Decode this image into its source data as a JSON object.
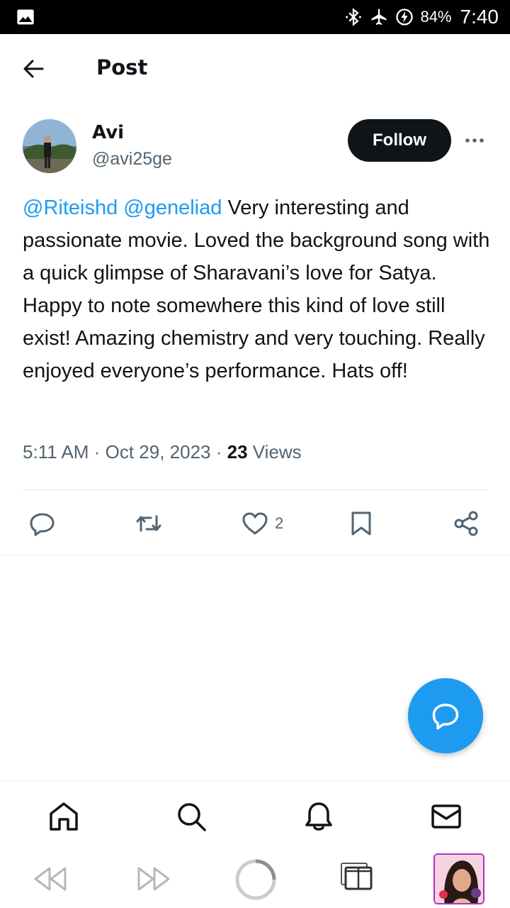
{
  "status_bar": {
    "battery": "84%",
    "time": "7:40",
    "icons": [
      "image-icon",
      "bluetooth-icon",
      "airplane-icon",
      "battery-saver-icon"
    ]
  },
  "header": {
    "title": "Post",
    "back_icon": "arrow-left-icon"
  },
  "author": {
    "name": "Avi",
    "handle": "@avi25ge",
    "follow_label": "Follow",
    "more_icon": "more-horizontal-icon"
  },
  "tweet": {
    "mention_1": "@Riteishd",
    "mention_2": "@geneliad",
    "text": "Very interesting and passionate movie. Loved the background song with a quick glimpse of Sharavani’s love for Satya. Happy to note somewhere this kind of love still exist! Amazing chemistry and very touching. Really enjoyed everyone’s performance. Hats off!",
    "time": "5:11 AM",
    "separator": "·",
    "date": "Oct 29, 2023",
    "views_count": "23",
    "views_label": "Views"
  },
  "actions": {
    "reply_icon": "reply-icon",
    "retweet_icon": "retweet-icon",
    "like_icon": "heart-icon",
    "like_count": "2",
    "bookmark_icon": "bookmark-icon",
    "share_icon": "share-icon"
  },
  "fab": {
    "icon": "compose-reply-icon"
  },
  "bottom_nav": [
    "home-icon",
    "search-icon",
    "bell-icon",
    "mail-icon"
  ],
  "system_bar": [
    "rewind-icon",
    "fast-forward-icon",
    "loading-ring-icon",
    "tabs-icon",
    "app-thumbnail"
  ],
  "colors": {
    "accent": "#1d9bf0",
    "text": "#0f1419",
    "secondary": "#536471",
    "follow_bg": "#0f1419"
  }
}
